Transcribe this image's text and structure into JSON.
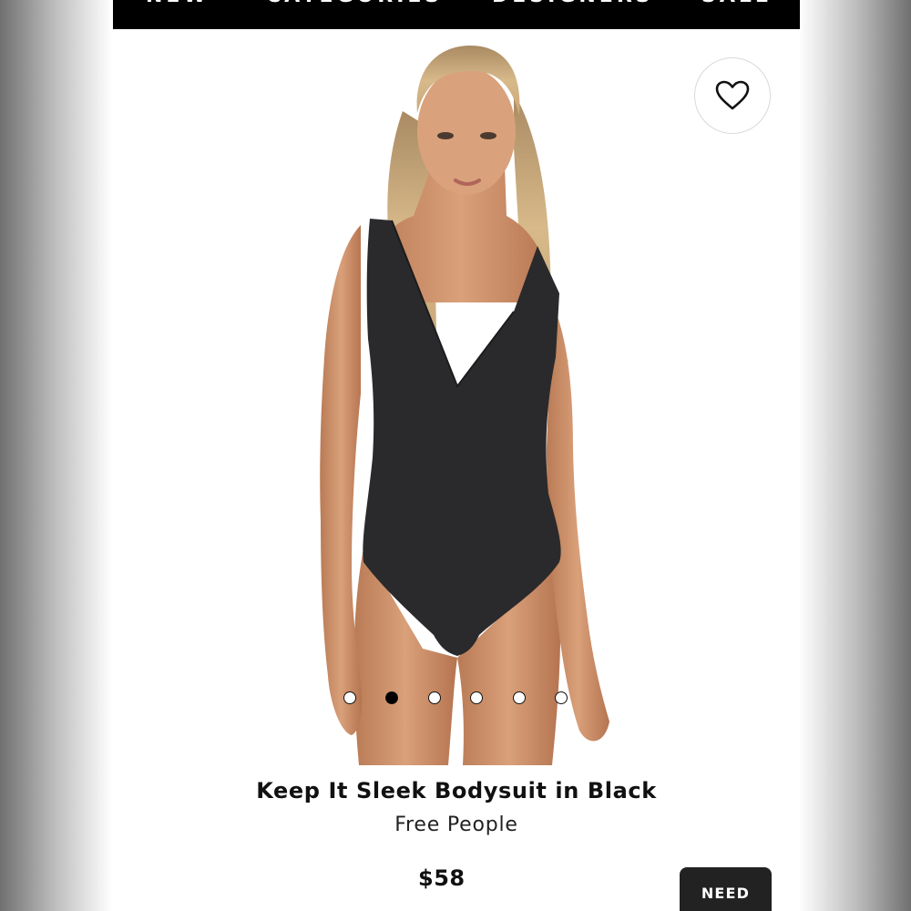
{
  "nav": {
    "items": [
      {
        "label": "NEW"
      },
      {
        "label": "CATEGORIES"
      },
      {
        "label": "DESIGNERS"
      },
      {
        "label": "SALE"
      }
    ]
  },
  "product": {
    "title": "Keep It Sleek Bodysuit in Black",
    "brand": "Free People",
    "price": "$58",
    "favorite_icon": "heart-outline-icon",
    "carousel": {
      "total": 6,
      "active_index": 1
    }
  },
  "actions": {
    "need_label": "NEED"
  },
  "colors": {
    "nav_bg": "#000000",
    "garment": "#2a2a2c",
    "button_bg": "#222222"
  }
}
